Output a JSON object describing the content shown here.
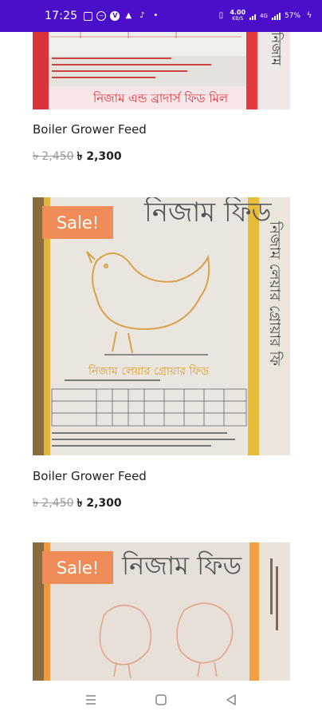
{
  "status_bar": {
    "time": "17:25",
    "left_icons": [
      "gallery-icon",
      "messenger-icon",
      "v-app-icon",
      "notification-icon",
      "tiktok-icon",
      "dot-icon"
    ],
    "net_speed_value": "4.00",
    "net_speed_unit": "KB/S",
    "network_label": "4G",
    "battery": "57%"
  },
  "products": [
    {
      "title": "Boiler Grower Feed",
      "old_price": "৳ 2,450",
      "new_price": "৳ 2,300",
      "image_text": "নিজাম এন্ড ব্রাদার্স ফিড মিল",
      "image_side_text": "নিজাম"
    },
    {
      "sale_label": "Sale!",
      "title": "Boiler Grower Feed",
      "old_price": "৳ 2,450",
      "new_price": "৳ 2,300",
      "image_text": "নিজাম ফিড",
      "image_subtitle": "নিজাম লেয়ার গ্রোয়ার ফিড",
      "image_side_text": "নিজাম লেয়ার গ্রোয়ার ফি"
    },
    {
      "sale_label": "Sale!",
      "image_text": "নিজাম ফিড"
    }
  ],
  "nav_bar": {
    "items": [
      "recents-icon",
      "home-icon",
      "back-icon"
    ]
  },
  "colors": {
    "status_bar": "#4b0fc9",
    "sale_badge": "#f08c57",
    "old_price": "#9a9a9a"
  }
}
